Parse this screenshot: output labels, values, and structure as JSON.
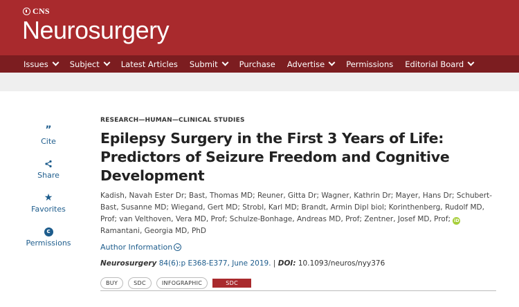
{
  "brand": {
    "society": "CNS",
    "journal_title": "Neurosurgery"
  },
  "nav": [
    {
      "label": "Issues",
      "has_dropdown": true
    },
    {
      "label": "Subject",
      "has_dropdown": true
    },
    {
      "label": "Latest Articles",
      "has_dropdown": false
    },
    {
      "label": "Submit",
      "has_dropdown": true
    },
    {
      "label": "Purchase",
      "has_dropdown": false
    },
    {
      "label": "Advertise",
      "has_dropdown": true
    },
    {
      "label": "Permissions",
      "has_dropdown": false
    },
    {
      "label": "Editorial Board",
      "has_dropdown": true
    }
  ],
  "tools": [
    {
      "label": "Cite",
      "icon": "quote-icon"
    },
    {
      "label": "Share",
      "icon": "share-icon"
    },
    {
      "label": "Favorites",
      "icon": "star-icon"
    },
    {
      "label": "Permissions",
      "icon": "copyright-icon"
    }
  ],
  "article": {
    "section": "RESEARCH—HUMAN—CLINICAL STUDIES",
    "title": "Epilepsy Surgery in the First 3 Years of Life: Predictors of Seizure Freedom and Cognitive Development",
    "authors_before_orcid": "Kadish, Navah Ester Dr; Bast, Thomas MD; Reuner, Gitta Dr; Wagner, Kathrin Dr; Mayer, Hans Dr; Schubert-Bast, Susanne MD; Wiegand, Gert MD; Strobl, Karl MD; Brandt, Armin Dipl biol; Korinthenberg, Rudolf MD, Prof; van Velthoven, Vera MD, Prof; Schulze-Bonhage, Andreas MD, Prof; Zentner, Josef MD, Prof;",
    "orcid_badge": "iD",
    "authors_after_orcid": "Ramantani, Georgia MD, PhD",
    "author_info_label": "Author Information",
    "journal": "Neurosurgery",
    "volume_pages": "84(6):p E368-E377, June 2019.",
    "separator": "|",
    "doi_label": "DOI:",
    "doi": "10.1093/neuros/nyy376"
  },
  "tags": [
    "BUY",
    "SDC",
    "INFOGRAPHIC"
  ],
  "tag_highlight": "SDC",
  "colors": {
    "brand_red": "#a92a2d",
    "nav_dark_red": "#7c1d20",
    "link_blue": "#1d5c8c",
    "orcid_green": "#a6ce39"
  }
}
